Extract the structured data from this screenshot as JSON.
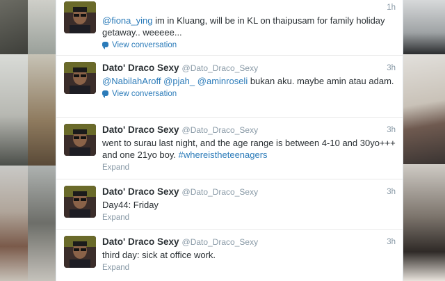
{
  "tweets": [
    {
      "fullname": "",
      "username": "",
      "time": "1h",
      "segments": [
        {
          "t": "mention",
          "v": "@fiona_ying"
        },
        {
          "t": "text",
          "v": " im in Kluang, will be in KL on thaipusam for family holiday getaway.. weeeee..."
        }
      ],
      "action": "View conversation",
      "action_type": "conversation"
    },
    {
      "fullname": "Dato' Draco Sexy",
      "username": "@Dato_Draco_Sexy",
      "time": "3h",
      "segments": [
        {
          "t": "mention",
          "v": "@NabilahAroff"
        },
        {
          "t": "text",
          "v": " "
        },
        {
          "t": "mention",
          "v": "@pjah_"
        },
        {
          "t": "text",
          "v": " "
        },
        {
          "t": "mention",
          "v": "@aminroseli"
        },
        {
          "t": "text",
          "v": " bukan aku. maybe amin atau adam."
        }
      ],
      "action": "View conversation",
      "action_type": "conversation"
    },
    {
      "fullname": "Dato' Draco Sexy",
      "username": "@Dato_Draco_Sexy",
      "time": "3h",
      "segments": [
        {
          "t": "text",
          "v": "went to surau last night, and the age range is between 4-10 and 30yo+++ and one 21yo boy. "
        },
        {
          "t": "hashtag",
          "v": "#whereistheteenagers"
        }
      ],
      "action": "Expand",
      "action_type": "expand"
    },
    {
      "fullname": "Dato' Draco Sexy",
      "username": "@Dato_Draco_Sexy",
      "time": "3h",
      "segments": [
        {
          "t": "text",
          "v": "Day44: Friday"
        }
      ],
      "action": "Expand",
      "action_type": "expand"
    },
    {
      "fullname": "Dato' Draco Sexy",
      "username": "@Dato_Draco_Sexy",
      "time": "3h",
      "segments": [
        {
          "t": "text",
          "v": "third day: sick at office work."
        }
      ],
      "action": "Expand",
      "action_type": "expand"
    }
  ],
  "colors": {
    "link": "#2b7bb9",
    "muted": "#8899a6",
    "text": "#292f33"
  },
  "icons": {
    "conversation": "speech-bubble-icon"
  }
}
